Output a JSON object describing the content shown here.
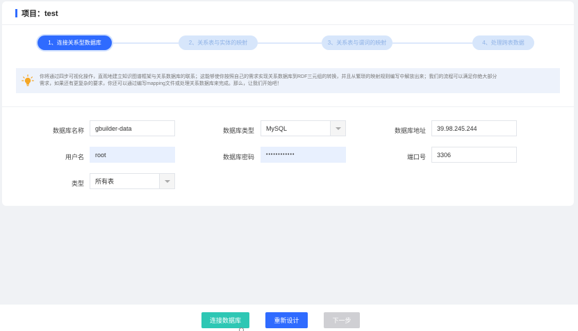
{
  "project": {
    "title": "项目：test"
  },
  "steps": [
    {
      "label": "1、连接关系型数据库"
    },
    {
      "label": "2、关系表与实体的映射"
    },
    {
      "label": "3、关系表与谓词的映射"
    },
    {
      "label": "4、处理跨表数据"
    }
  ],
  "info": {
    "icon": "lightbulb-icon",
    "line1": "你将通过四步可视化操作，直观地建立知识图谱框架与关系数据库的联系；这能够使你按照自己的需求实现关系数据库到RDF三元组的转换，并且从繁琐的映射规则编写中解放出来；我们的流程可以满足你绝大部分",
    "line2": "需求，如果还有更复杂的要求，你还可以通过编写mapping文件或处理关系数据库来完成。那么，让我们开始吧！"
  },
  "form": {
    "db_name": {
      "label": "数据库名称",
      "value": "gbuilder-data"
    },
    "db_type": {
      "label": "数据库类型",
      "value": "MySQL"
    },
    "db_address": {
      "label": "数据库地址",
      "value": "39.98.245.244"
    },
    "username": {
      "label": "用户名",
      "value": "root"
    },
    "password": {
      "label": "数据库密码",
      "value": "••••••••••••"
    },
    "port": {
      "label": "端口号",
      "value": "3306"
    },
    "type": {
      "label": "类型",
      "value": "所有表"
    }
  },
  "footer": {
    "connect": "连接数据库",
    "redesign": "重新设计",
    "next": "下一步"
  },
  "colors": {
    "accent": "#2f6bff",
    "connect": "#2ec7b4",
    "disabled": "#cfcfd3",
    "info_bg": "#edf2fb"
  }
}
